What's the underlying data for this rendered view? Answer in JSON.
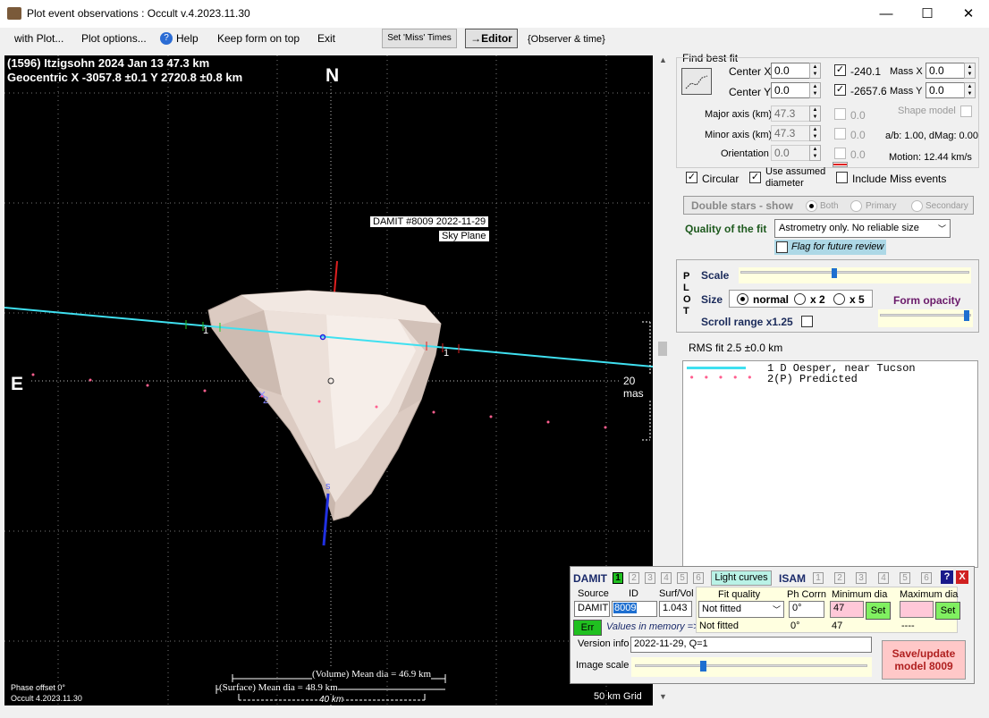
{
  "window": {
    "title": "Plot event observations : Occult v.4.2023.11.30",
    "minimize": "—",
    "maximize": "☐",
    "close": "✕"
  },
  "menu": {
    "with_plot": "with Plot...",
    "plot_options": "Plot options...",
    "help": "Help",
    "keep_on_top": "Keep form on top",
    "exit": "Exit",
    "set_miss": "Set 'Miss' Times",
    "editor": "→Editor",
    "observer_time": "{Observer & time}"
  },
  "plot": {
    "header1": "(1596) Itzigsohn  2024 Jan 13  47.3 km",
    "header2": "Geocentric  X  -3057.8 ±0.1  Y 2720.8 ±0.8 km",
    "north": "N",
    "east": "E",
    "south_marker": "S",
    "model_label1": "DAMIT #8009 2022-11-29",
    "model_label2": "Sky Plane",
    "chord1": "1",
    "chord1b": "1",
    "chord2": "2",
    "scale_mas": "20 mas",
    "volume_dia": "(Volume) Mean dia = 46.9 km",
    "surface_dia": "(Surface) Mean dia = 48.9 km",
    "scale_km": "40 km",
    "grid": "50 km Grid",
    "phase": "Phase offset 0°",
    "version": "Occult 4.2023.11.30"
  },
  "fit": {
    "title": "Find best fit",
    "center_x_label": "Center X",
    "center_x": "0.0",
    "center_y_label": "Center Y",
    "center_y": "0.0",
    "cx_val": "-240.1",
    "cy_val": "-2657.6",
    "mass_x_label": "Mass X",
    "mass_x": "0.0",
    "mass_y_label": "Mass Y",
    "mass_y": "0.0",
    "major_label": "Major axis (km)",
    "major": "47.3",
    "minor_label": "Minor axis (km)",
    "minor": "47.3",
    "orient_label": "Orientation",
    "orient": "0.0",
    "maj_chk": "0.0",
    "min_chk": "0.0",
    "ori_chk": "0.0",
    "shape_model": "Shape model",
    "ab": "a/b: 1.00, dMag: 0.00",
    "motion": "Motion: 12.44 km/s",
    "circular": "Circular",
    "use_assumed": "Use assumed",
    "diameter": "diameter",
    "include_miss": "Include Miss events",
    "double_stars": "Double stars - show",
    "both": "Both",
    "primary": "Primary",
    "secondary": "Secondary",
    "quality_label": "Quality of the fit",
    "quality_value": "Astrometry only. No reliable size",
    "flag_review": "Flag for future review"
  },
  "plotctl": {
    "p": "P",
    "l": "L",
    "o": "O",
    "t": "T",
    "scale": "Scale",
    "size": "Size",
    "normal": "normal",
    "x2": "x 2",
    "x5": "x 5",
    "form_opacity": "Form opacity",
    "scroll_range": "Scroll range x1.25",
    "rms": "RMS fit 2.5 ±0.0 km"
  },
  "legend": {
    "row1": "1    D Oesper, near Tucson",
    "row2": "2(P) Predicted"
  },
  "damit": {
    "damit": "DAMIT",
    "isam": "ISAM",
    "light_curves": "Light curves",
    "n1": "1",
    "n2": "2",
    "n3": "3",
    "n4": "4",
    "n5": "5",
    "n6": "6",
    "source_label": "Source",
    "id_label": "ID",
    "surf_label": "Surf/Vol",
    "source": "DAMIT",
    "id": "8009",
    "surf": "1.043",
    "err": "Err",
    "values_memory": "Values in memory =>",
    "fit_quality_label": "Fit quality",
    "fit_quality": "Not fitted",
    "fit_quality_mem": "Not fitted",
    "ph_corr_label": "Ph Corrn",
    "ph_corr": "0°",
    "ph_corr_mem": "0°",
    "min_dia_label": "Minimum dia",
    "min_dia": "47",
    "min_dia_mem": "47",
    "max_dia_label": "Maximum dia",
    "max_dia": "",
    "max_dia_mem": "----",
    "set": "Set",
    "version_label": "Version info",
    "version": "2022-11-29, Q=1",
    "image_scale": "Image scale",
    "save": "Save/update",
    "save2": "model 8009",
    "q": "?",
    "x": "X"
  },
  "colors": {
    "chord": "#3fe0f0",
    "predicted": "#ff5f8f",
    "shape": "#e6d8cf",
    "accent_green": "#1e5a1e",
    "save_bg": "#ffc8c8"
  }
}
